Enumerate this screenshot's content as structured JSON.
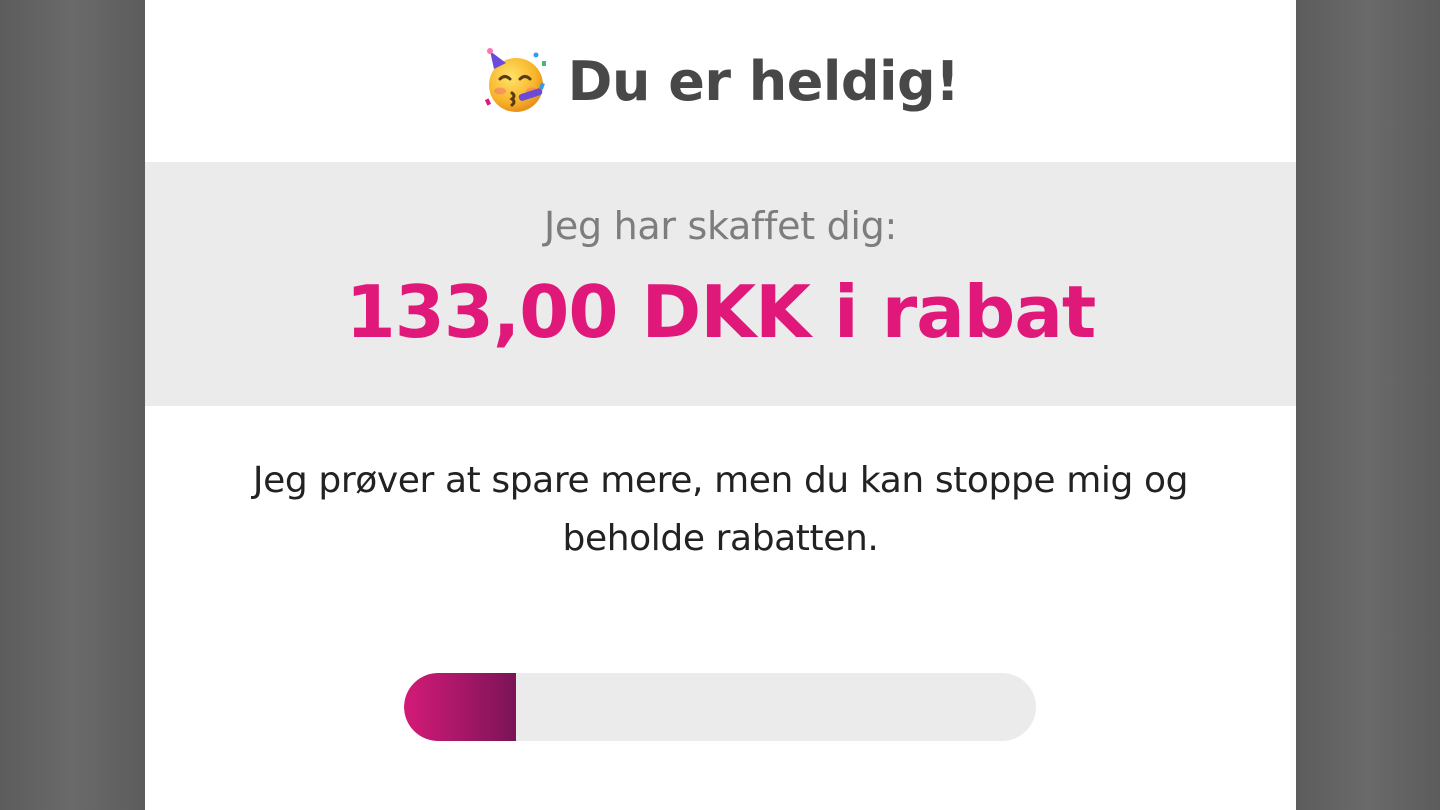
{
  "header": {
    "emoji_icon": "partying-face-icon",
    "title": "Du er heldig!"
  },
  "savings": {
    "subtitle": "Jeg har skaffet dig:",
    "amount_text": "133,00 DKK i rabat"
  },
  "message": "Jeg prøver at spare mere, men du kan stoppe mig og beholde rabatten.",
  "progress": {
    "fraction": 0.177
  },
  "colors": {
    "accent": "#e0187a",
    "accent_dark": "#7a1456",
    "panel_bg": "#ffffff",
    "box_bg": "#ebebeb",
    "backdrop": "#646464"
  }
}
